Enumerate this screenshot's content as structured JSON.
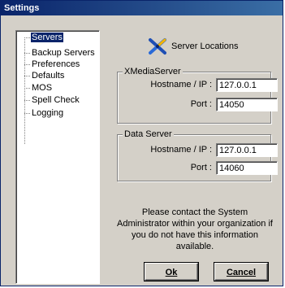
{
  "window": {
    "title": "Settings"
  },
  "nav": {
    "items": [
      {
        "label": "Servers",
        "selected": true
      },
      {
        "label": "Backup Servers"
      },
      {
        "label": "Preferences"
      },
      {
        "label": "Defaults"
      },
      {
        "label": "MOS"
      },
      {
        "label": "Spell Check"
      },
      {
        "label": "Logging"
      }
    ]
  },
  "header": {
    "title": "Server Locations",
    "icon": "server-locations-icon"
  },
  "xmedia_group": {
    "title": "XMediaServer",
    "host_label": "Hostname / IP :",
    "host_value": "127.0.0.1",
    "port_label": "Port :",
    "port_value": "14050"
  },
  "data_group": {
    "title": "Data Server",
    "host_label": "Hostname / IP :",
    "host_value": "127.0.0.1",
    "port_label": "Port :",
    "port_value": "14060"
  },
  "notice": "Please contact the System Administrator within your organization if you do not have this information available.",
  "buttons": {
    "ok_label": "Ok",
    "cancel_label": "Cancel"
  },
  "colors": {
    "titlebar": "#0a246a",
    "face": "#d4d0c8",
    "selection": "#0a246a"
  }
}
